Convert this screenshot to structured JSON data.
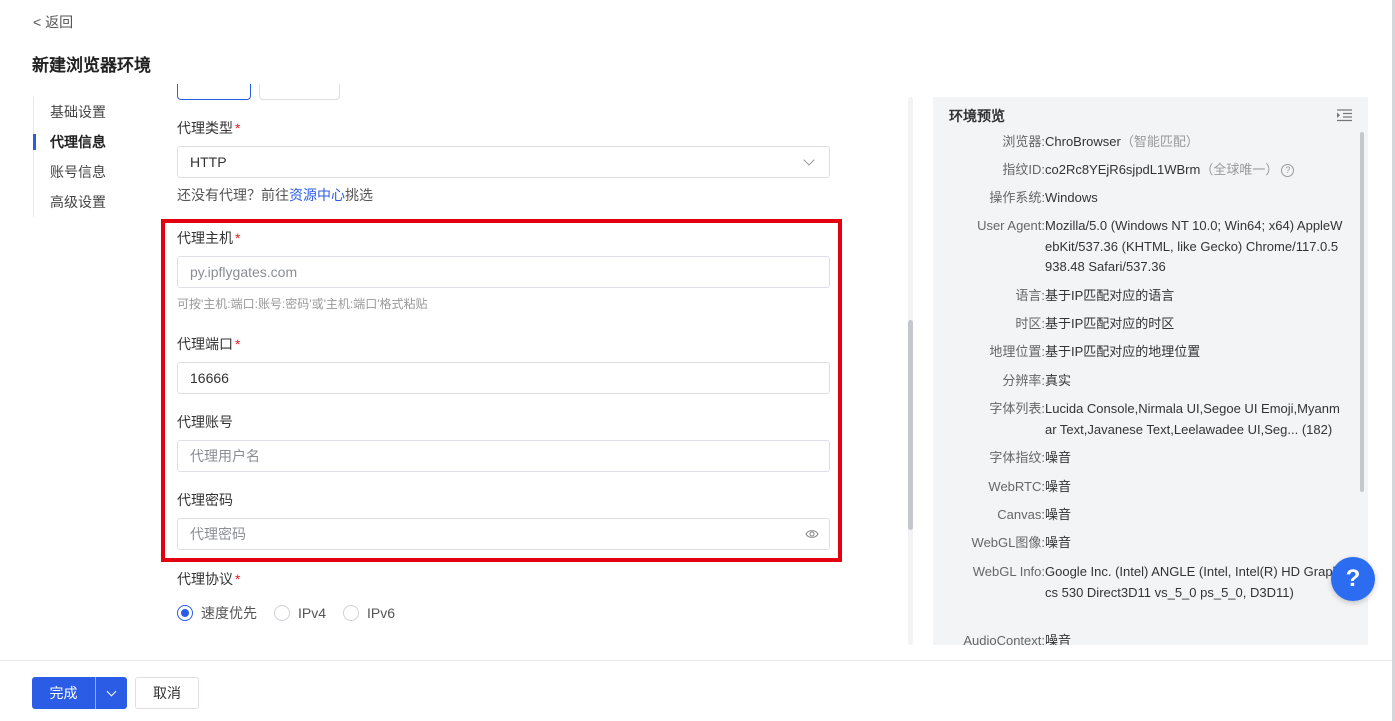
{
  "nav": {
    "back_label": "< 返回"
  },
  "page_title": "新建浏览器环境",
  "side_nav": [
    {
      "label": "基础设置",
      "active": false
    },
    {
      "label": "代理信息",
      "active": true
    },
    {
      "label": "账号信息",
      "active": false
    },
    {
      "label": "高级设置",
      "active": false
    }
  ],
  "form": {
    "proxy_type": {
      "label": "代理类型",
      "value": "HTTP"
    },
    "no_proxy_hint": {
      "prefix": "还没有代理？前往",
      "link": "资源中心",
      "suffix": "挑选"
    },
    "proxy_host": {
      "label": "代理主机",
      "value": "py.ipflygates.com",
      "hint": "可按'主机:端口:账号:密码'或'主机:端口'格式粘贴"
    },
    "proxy_port": {
      "label": "代理端口",
      "value": "16666"
    },
    "proxy_account": {
      "label": "代理账号",
      "placeholder": "代理用户名"
    },
    "proxy_password": {
      "label": "代理密码",
      "placeholder": "代理密码"
    },
    "proxy_protocol": {
      "label": "代理协议",
      "options": [
        "速度优先",
        "IPv4",
        "IPv6"
      ],
      "selected": "速度优先"
    },
    "required_mark": "*"
  },
  "preview": {
    "title": "环境预览",
    "rows": {
      "browser": {
        "key": "浏览器:",
        "value": "ChroBrowser",
        "note": "（智能匹配）"
      },
      "fingerprint": {
        "key": "指纹ID:",
        "value": "co2Rc8YEjR6sjpdL1WBrm",
        "note": "（全球唯一）",
        "help": "?"
      },
      "os": {
        "key": "操作系统:",
        "value": "Windows"
      },
      "ua": {
        "key": "User Agent:",
        "value": "Mozilla/5.0 (Windows NT 10.0; Win64; x64) AppleWebKit/537.36 (KHTML, like Gecko) Chrome/117.0.5938.48 Safari/537.36"
      },
      "language": {
        "key": "语言:",
        "value": "基于IP匹配对应的语言"
      },
      "timezone": {
        "key": "时区:",
        "value": "基于IP匹配对应的时区"
      },
      "geo": {
        "key": "地理位置:",
        "value": "基于IP匹配对应的地理位置"
      },
      "resolution": {
        "key": "分辨率:",
        "value": "真实"
      },
      "fonts": {
        "key": "字体列表:",
        "value": "Lucida Console,Nirmala UI,Segoe UI Emoji,Myanmar Text,Javanese Text,Leelawadee UI,Seg...",
        "count": "(182)"
      },
      "font_fp": {
        "key": "字体指纹:",
        "value": "噪音"
      },
      "webrtc": {
        "key": "WebRTC:",
        "value": "噪音"
      },
      "canvas": {
        "key": "Canvas:",
        "value": "噪音"
      },
      "webgl_img": {
        "key": "WebGL图像:",
        "value": "噪音"
      },
      "webgl_info": {
        "key": "WebGL Info:",
        "value": "Google Inc. (Intel) ANGLE (Intel, Intel(R) HD Graphics 530 Direct3D11 vs_5_0 ps_5_0, D3D11)"
      },
      "audio": {
        "key": "AudioContext:",
        "value": "噪音"
      }
    }
  },
  "help_button": "?",
  "footer": {
    "done_label": "完成",
    "cancel_label": "取消"
  },
  "colors": {
    "primary": "#2b5ce6",
    "highlight_border": "#e3000f",
    "required": "#e02020"
  }
}
